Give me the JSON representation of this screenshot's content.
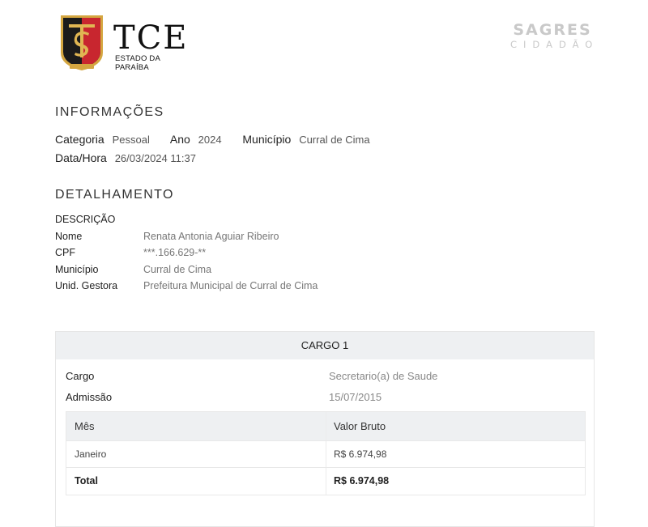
{
  "header": {
    "org_name": "TCE",
    "org_subtitle": "ESTADO DA PARAÍBA",
    "app_brand_top": "SAGRES",
    "app_brand_bottom": "CIDADÃO"
  },
  "info": {
    "title": "INFORMAÇÕES",
    "categoria_label": "Categoria",
    "categoria_value": "Pessoal",
    "ano_label": "Ano",
    "ano_value": "2024",
    "municipio_label": "Município",
    "municipio_value": "Curral de Cima",
    "datahora_label": "Data/Hora",
    "datahora_value": "26/03/2024 11:37"
  },
  "detalhamento": {
    "title": "DETALHAMENTO",
    "descricao_label": "DESCRIÇÃO",
    "rows": [
      {
        "label": "Nome",
        "value": "Renata Antonia Aguiar Ribeiro"
      },
      {
        "label": "CPF",
        "value": "***.166.629-**"
      },
      {
        "label": "Município",
        "value": "Curral de Cima"
      },
      {
        "label": "Unid. Gestora",
        "value": "Prefeitura Municipal de Curral de Cima"
      }
    ]
  },
  "cargo": {
    "header": "CARGO 1",
    "cargo_label": "Cargo",
    "cargo_value": "Secretario(a) de Saude",
    "admissao_label": "Admissão",
    "admissao_value": "15/07/2015",
    "table": {
      "col_mes": "Mês",
      "col_valor": "Valor Bruto",
      "rows": [
        {
          "mes": "Janeiro",
          "valor": "R$ 6.974,98"
        }
      ],
      "total_label": "Total",
      "total_value": "R$ 6.974,98"
    }
  },
  "colors": {
    "seal_red": "#c8262f",
    "seal_black": "#1b1b1b",
    "seal_gold": "#d4a640",
    "brand_gray": "#c9c9c9",
    "header_bg": "#eef0f2"
  }
}
